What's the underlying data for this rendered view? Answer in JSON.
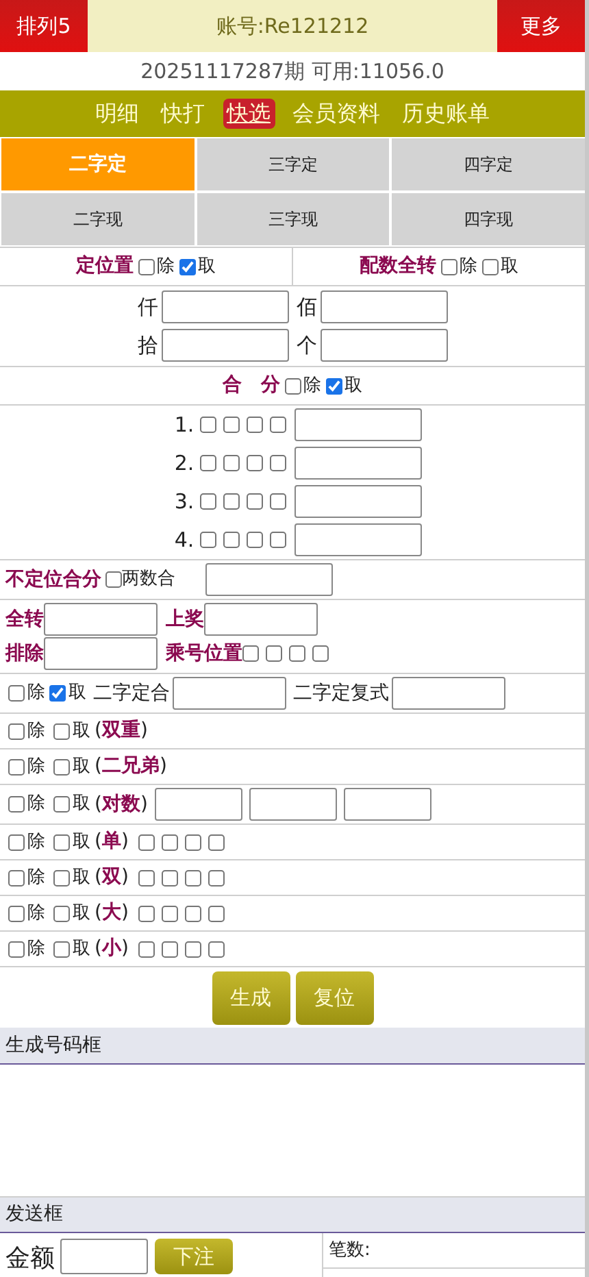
{
  "header": {
    "left_button": "排列5",
    "account": "账号:Re121212",
    "right_button": "更多"
  },
  "period_line": "20251117287期 可用:11056.0",
  "nav": [
    {
      "label": "明细",
      "selected": false
    },
    {
      "label": "快打",
      "selected": false
    },
    {
      "label": "快选",
      "selected": true
    },
    {
      "label": "会员资料",
      "selected": false
    },
    {
      "label": "历史账单",
      "selected": false
    }
  ],
  "play_tabs": [
    {
      "label": "二字定",
      "selected": true
    },
    {
      "label": "三字定",
      "selected": false
    },
    {
      "label": "四字定",
      "selected": false
    },
    {
      "label": "二字现",
      "selected": false
    },
    {
      "label": "三字现",
      "selected": false
    },
    {
      "label": "四字现",
      "selected": false
    }
  ],
  "position_section": {
    "title": "定位置",
    "options": [
      {
        "label": "除",
        "checked": false
      },
      {
        "label": "取",
        "checked": true
      }
    ]
  },
  "transform_section": {
    "title": "配数全转",
    "options": [
      {
        "label": "除",
        "checked": false
      },
      {
        "label": "取",
        "checked": false
      }
    ]
  },
  "position_fields": [
    {
      "label": "仟"
    },
    {
      "label": "佰"
    },
    {
      "label": "拾"
    },
    {
      "label": "个"
    }
  ],
  "sum_section": {
    "title": "合　分",
    "options": [
      {
        "label": "除",
        "checked": false
      },
      {
        "label": "取",
        "checked": true
      }
    ]
  },
  "sum_rows": [
    {
      "label": "1.",
      "boxes": [
        {
          "checked": false
        },
        {
          "checked": false
        },
        {
          "checked": false
        },
        {
          "checked": false
        }
      ]
    },
    {
      "label": "2.",
      "boxes": [
        {
          "checked": false
        },
        {
          "checked": false
        },
        {
          "checked": false
        },
        {
          "checked": false
        }
      ]
    },
    {
      "label": "3.",
      "boxes": [
        {
          "checked": false
        },
        {
          "checked": false
        },
        {
          "checked": false
        },
        {
          "checked": false
        }
      ]
    },
    {
      "label": "4.",
      "boxes": [
        {
          "checked": false
        },
        {
          "checked": false
        },
        {
          "checked": false
        },
        {
          "checked": false
        }
      ]
    }
  ],
  "unfixed_sum": {
    "title": "不定位合分",
    "option": {
      "label": "两数合",
      "checked": false
    }
  },
  "transform_fields": [
    {
      "label": "全转"
    },
    {
      "label": "上奖"
    }
  ],
  "exclude_field": {
    "label": "排除"
  },
  "multiply_position": {
    "label": "乘号位置",
    "boxes": [
      {
        "checked": false
      },
      {
        "checked": false
      },
      {
        "checked": false
      },
      {
        "checked": false
      }
    ]
  },
  "combo_row": {
    "options": [
      {
        "label": "除",
        "checked": false
      },
      {
        "label": "取",
        "checked": true
      }
    ],
    "fields": [
      {
        "label": "二字定合"
      },
      {
        "label": "二字定复式"
      }
    ]
  },
  "filter_rows": [
    {
      "kind": "plain",
      "label": "(**双重**)",
      "options": [
        {
          "label": "除",
          "checked": false
        },
        {
          "label": "取",
          "checked": false
        }
      ]
    },
    {
      "kind": "plain",
      "label": "(**二兄弟**)",
      "options": [
        {
          "label": "除",
          "checked": false
        },
        {
          "label": "取",
          "checked": false
        }
      ]
    },
    {
      "kind": "fields",
      "label": "(**对数**)",
      "options": [
        {
          "label": "除",
          "checked": false
        },
        {
          "label": "取",
          "checked": false
        }
      ]
    },
    {
      "kind": "boxes",
      "label": "(**单**)",
      "options": [
        {
          "label": "除",
          "checked": false
        },
        {
          "label": "取",
          "checked": false
        }
      ],
      "boxes": [
        {
          "checked": false
        },
        {
          "checked": false
        },
        {
          "checked": false
        },
        {
          "checked": false
        }
      ]
    },
    {
      "kind": "boxes",
      "label": "(**双**)",
      "options": [
        {
          "label": "除",
          "checked": false
        },
        {
          "label": "取",
          "checked": false
        }
      ],
      "boxes": [
        {
          "checked": false
        },
        {
          "checked": false
        },
        {
          "checked": false
        },
        {
          "checked": false
        }
      ]
    },
    {
      "kind": "boxes",
      "label": "(**大**)",
      "options": [
        {
          "label": "除",
          "checked": false
        },
        {
          "label": "取",
          "checked": false
        }
      ],
      "boxes": [
        {
          "checked": false
        },
        {
          "checked": false
        },
        {
          "checked": false
        },
        {
          "checked": false
        }
      ]
    },
    {
      "kind": "boxes",
      "label": "(**小**)",
      "options": [
        {
          "label": "除",
          "checked": false
        },
        {
          "label": "取",
          "checked": false
        }
      ],
      "boxes": [
        {
          "checked": false
        },
        {
          "checked": false
        },
        {
          "checked": false
        },
        {
          "checked": false
        }
      ]
    }
  ],
  "buttons": [
    "生成",
    "复位"
  ],
  "generated_box": {
    "title": "生成号码框"
  },
  "send_box": {
    "title": "发送框",
    "amount_label": "金额",
    "submit": "下注",
    "count_label": "笔数:"
  }
}
